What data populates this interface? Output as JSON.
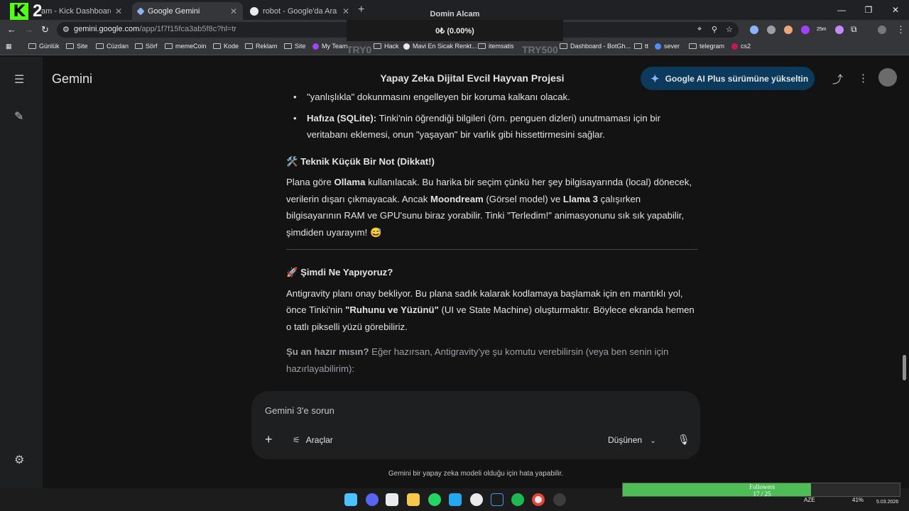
{
  "browser": {
    "tabs": [
      {
        "title": "am - Kick Dashboard"
      },
      {
        "title": "Google Gemini"
      },
      {
        "title": "robot - Google'da Ara"
      }
    ],
    "url_host": "gemini.google.com",
    "url_path": "/app/1f7f15fca3ab5f8c?hl=tr",
    "bookmarks": [
      "Günlük",
      "Site",
      "Cüzdan",
      "Sörf",
      "memeCoin",
      "Kode",
      "Reklam",
      "Site",
      "My Team",
      "Hack",
      "Mavi En Sicak Renkt...",
      "itemsatis",
      "Dashboard - BotGh...",
      "tt",
      "sever",
      "telegram",
      "cs2"
    ],
    "ext_badge": "25m"
  },
  "overlay": {
    "kick_num": "2",
    "domain_title": "Domin Alcam",
    "domain_value": "0₺ (0.00%)",
    "try_left": "TRY0",
    "try_right": "TRY500"
  },
  "app": {
    "brand": "Gemini",
    "conversation_title": "Yapay Zeka Dijital Evcil Hayvan Projesi",
    "upgrade_label": "Google AI Plus sürümüne yükseltin"
  },
  "message": {
    "line0": "\"yanlışlıkla\" dokunmasını engelleyen bir koruma kalkanı olacak.",
    "b_bold": "Hafıza (SQLite):",
    "b_text": " Tinki'nin öğrendiği bilgileri (örn. penguen dizleri) unutmaması için bir veritabanı eklemesi, onun \"yaşayan\" bir varlık gibi hissettirmesini sağlar.",
    "h_note": "🛠️ Teknik Küçük Bir Not (Dikkat!)",
    "p1_a": "Plana göre ",
    "p1_b": "Ollama",
    "p1_c": " kullanılacak. Bu harika bir seçim çünkü her şey bilgisayarında (local) dönecek, verilerin dışarı çıkmayacak. Ancak ",
    "p1_d": "Moondream",
    "p1_e": " (Görsel model) ve ",
    "p1_f": "Llama 3",
    "p1_g": " çalışırken bilgisayarının RAM ve GPU'sunu biraz yorabilir. Tinki \"Terledim!\" animasyonunu sık sık yapabilir, şimdiden uyarayım! 😅",
    "h_now": "🚀 Şimdi Ne Yapıyoruz?",
    "p2_a": "Antigravity planı onay bekliyor. Bu plana sadık kalarak kodlamaya başlamak için en mantıklı yol, önce Tinki'nin ",
    "p2_b": "\"Ruhunu ve Yüzünü\"",
    "p2_c": " (UI ve State Machine) oluşturmaktır. Böylece ekranda hemen o tatlı pikselli yüzü görebiliriz.",
    "p3_a": "Şu an hazır mısın?",
    "p3_b": " Eğer hazırsan, Antigravity'ye şu komutu verebilirsin (veya ben senin için hazırlayabilirim):"
  },
  "composer": {
    "placeholder": "Gemini 3'e sorun",
    "tools_label": "Araçlar",
    "mode_label": "Düşünen"
  },
  "disclaimer": "Gemini bir yapay zeka modeli olduğu için hata yapabilir.",
  "followers": {
    "label": "Followers",
    "count": "17 / 25",
    "progress": 0.68
  },
  "tray": {
    "lang": "AZE",
    "battery": "41%",
    "date": "5.03.2026"
  }
}
